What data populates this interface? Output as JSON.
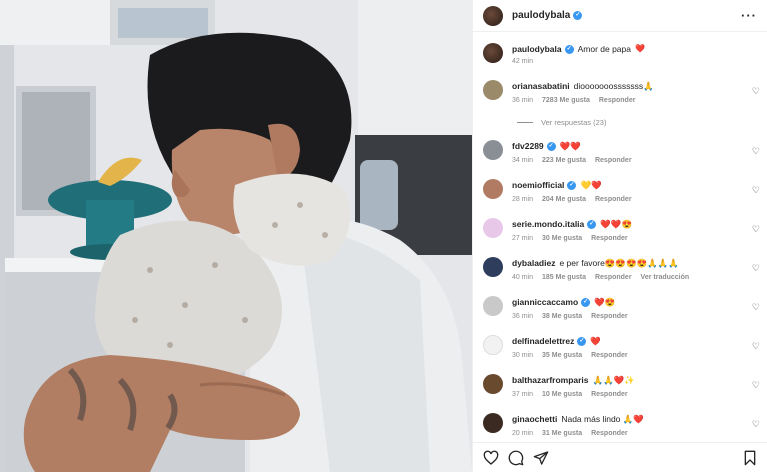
{
  "header": {
    "username": "paulodybala",
    "verified_mark": "✓"
  },
  "post": {
    "caption": {
      "username": "paulodybala",
      "text": "Amor de papa",
      "emoji": "❤️",
      "time": "42 min"
    }
  },
  "labels": {
    "like": "Me gusta",
    "reply": "Responder",
    "translate": "Ver traducción"
  },
  "comments": [
    {
      "username": "orianasabatini",
      "verified": false,
      "text": "diooooooosssssss🙏",
      "time": "36 min",
      "likes": "7283 Me gusta",
      "reply": "Responder",
      "translate": "",
      "avatar_color": "#9a8a6a"
    },
    {
      "username": "fdv2289",
      "verified": true,
      "text": "❤️❤️",
      "time": "34 min",
      "likes": "223 Me gusta",
      "reply": "Responder",
      "translate": "",
      "avatar_color": "#8a8f96"
    },
    {
      "username": "noemiofficial",
      "verified": true,
      "text": "💛❤️",
      "time": "28 min",
      "likes": "204 Me gusta",
      "reply": "Responder",
      "translate": "",
      "avatar_color": "#b07a63"
    },
    {
      "username": "serie.mondo.italia",
      "verified": true,
      "text": "❤️❤️😍",
      "time": "27 min",
      "likes": "30 Me gusta",
      "reply": "Responder",
      "translate": "",
      "avatar_color": "#e8c8e8"
    },
    {
      "username": "dybaladiez",
      "verified": false,
      "text": "e per favore😍😍😍😍🙏🙏🙏",
      "time": "40 min",
      "likes": "185 Me gusta",
      "reply": "Responder",
      "translate": "Ver traducción",
      "avatar_color": "#2e3d5c"
    },
    {
      "username": "gianniccaccamo",
      "verified": true,
      "text": "❤️😍",
      "time": "36 min",
      "likes": "38 Me gusta",
      "reply": "Responder",
      "translate": "",
      "avatar_color": "#c9c9c9"
    },
    {
      "username": "delfinadelettrez",
      "verified": true,
      "text": "❤️",
      "time": "30 min",
      "likes": "35 Me gusta",
      "reply": "Responder",
      "translate": "",
      "avatar_color": "#f2f2f2"
    },
    {
      "username": "balthazarfromparis",
      "verified": false,
      "text": "🙏🙏❤️✨",
      "time": "37 min",
      "likes": "10 Me gusta",
      "reply": "Responder",
      "translate": "",
      "avatar_color": "#6a4a2e"
    },
    {
      "username": "ginaochetti",
      "verified": false,
      "text": "Nada más lindo 🙏❤️",
      "time": "20 min",
      "likes": "31 Me gusta",
      "reply": "Responder",
      "translate": "",
      "avatar_color": "#3a2a22"
    }
  ],
  "view_replies": "Ver respuestas (23)",
  "icons": {
    "more": "more-options-icon",
    "like": "heart-outline-icon",
    "comment": "comment-bubble-icon",
    "share": "paper-plane-icon",
    "save": "bookmark-icon"
  },
  "colors": {
    "verified": "#3897f0",
    "muted": "#8e8e8e",
    "text": "#262626"
  }
}
